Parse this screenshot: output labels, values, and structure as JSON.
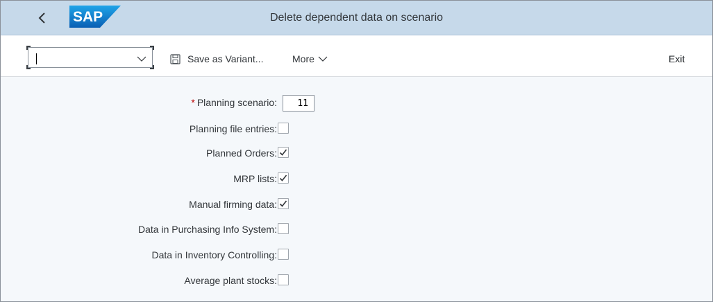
{
  "shell": {
    "logo_text": "SAP",
    "title": "Delete dependent data on scenario"
  },
  "toolbar": {
    "command_value": "",
    "save_variant_label": "Save as Variant...",
    "more_label": "More",
    "exit_label": "Exit"
  },
  "form": {
    "planning_scenario": {
      "label": "Planning scenario:",
      "value": "11",
      "required": true
    },
    "fields": [
      {
        "label": "Planning file entries:",
        "checked": false
      },
      {
        "label": "Planned Orders:",
        "checked": true
      },
      {
        "label": "MRP lists:",
        "checked": true
      },
      {
        "label": "Manual firming data:",
        "checked": true
      },
      {
        "label": "Data in Purchasing Info System:",
        "checked": false
      },
      {
        "label": "Data in Inventory Controlling:",
        "checked": false
      },
      {
        "label": "Average plant stocks:",
        "checked": false
      }
    ]
  },
  "colors": {
    "shell_bg": "#c6d9ea",
    "brand_blue": "#0a6ed1",
    "required": "#bb0000"
  }
}
